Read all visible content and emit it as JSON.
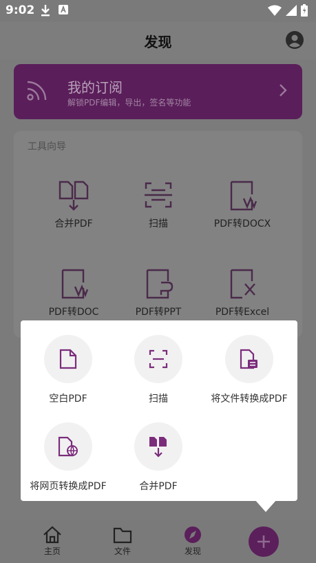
{
  "status_bar": {
    "time": "9:02"
  },
  "header": {
    "title": "发现"
  },
  "subscription": {
    "title": "我的订阅",
    "description": "解锁PDF编辑，导出，签名等功能"
  },
  "tools": {
    "heading": "工具向导",
    "items": [
      {
        "label": "合并PDF",
        "icon": "merge-pdf-icon"
      },
      {
        "label": "扫描",
        "icon": "scan-icon"
      },
      {
        "label": "PDF转DOCX",
        "icon": "pdf-to-docx-icon"
      },
      {
        "label": "PDF转DOC",
        "icon": "pdf-to-doc-icon"
      },
      {
        "label": "PDF转PPT",
        "icon": "pdf-to-ppt-icon"
      },
      {
        "label": "PDF转Excel",
        "icon": "pdf-to-excel-icon"
      }
    ]
  },
  "create_menu": {
    "items": [
      {
        "label": "空白PDF",
        "icon": "blank-page-icon"
      },
      {
        "label": "扫描",
        "icon": "scan-icon"
      },
      {
        "label": "将文件转换成PDF",
        "icon": "file-convert-icon"
      },
      {
        "label": "将网页转换成PDF",
        "icon": "web-page-icon"
      },
      {
        "label": "合并PDF",
        "icon": "merge-icon"
      }
    ]
  },
  "bottom_nav": {
    "items": [
      {
        "label": "主页",
        "icon": "home-icon"
      },
      {
        "label": "文件",
        "icon": "folder-icon"
      },
      {
        "label": "发现",
        "icon": "compass-icon",
        "active": true
      }
    ],
    "fab_icon": "plus-icon"
  },
  "colors": {
    "accent": "#6b2c6b",
    "scrim": "#7b7b7b",
    "popup_bg": "#ffffff"
  }
}
